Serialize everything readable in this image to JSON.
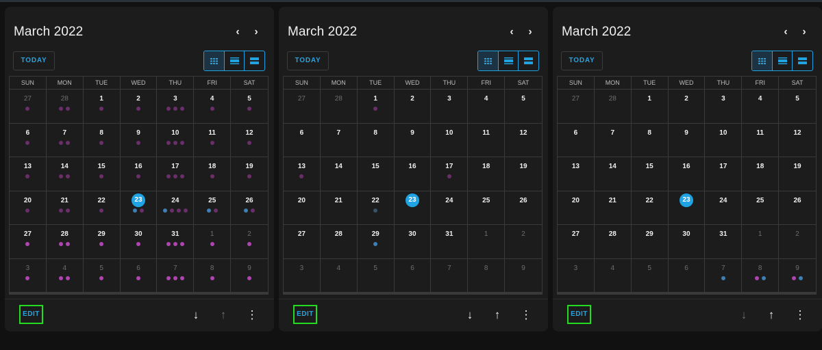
{
  "colors": {
    "accent": "#1fa3e3",
    "purple_dim": "#6a2f6a",
    "purple": "#b044b0",
    "blue": "#3f7fb3",
    "disabled": "#6e6e6e"
  },
  "icons": {
    "prev": "chevron-left-icon",
    "next": "chevron-right-icon",
    "month_view": "grid-icon",
    "week_view": "list-icon",
    "day_view": "agenda-icon",
    "down": "arrow-down-icon",
    "up": "arrow-up-icon",
    "more": "dots-vertical-icon"
  },
  "cards": [
    {
      "title": "March 2022",
      "today_label": "TODAY",
      "edit_label": "EDIT",
      "down_disabled": false,
      "up_disabled": true,
      "weekdays": [
        "SUN",
        "MON",
        "TUE",
        "WED",
        "THU",
        "FRI",
        "SAT"
      ],
      "days": [
        {
          "d": "27",
          "o": true,
          "dots": [
            "pd"
          ]
        },
        {
          "d": "28",
          "o": true,
          "dots": [
            "pd",
            "pd"
          ]
        },
        {
          "d": "1",
          "dots": [
            "pd"
          ]
        },
        {
          "d": "2",
          "dots": [
            "pd"
          ]
        },
        {
          "d": "3",
          "dots": [
            "pd",
            "pd",
            "pd"
          ]
        },
        {
          "d": "4",
          "dots": [
            "pd"
          ]
        },
        {
          "d": "5",
          "dots": [
            "pd"
          ]
        },
        {
          "d": "6",
          "dots": [
            "pd"
          ]
        },
        {
          "d": "7",
          "dots": [
            "pd",
            "pd"
          ]
        },
        {
          "d": "8",
          "dots": [
            "pd"
          ]
        },
        {
          "d": "9",
          "dots": [
            "pd"
          ]
        },
        {
          "d": "10",
          "dots": [
            "pd",
            "pd",
            "pd"
          ]
        },
        {
          "d": "11",
          "dots": [
            "pd"
          ]
        },
        {
          "d": "12",
          "dots": [
            "pd"
          ]
        },
        {
          "d": "13",
          "dots": [
            "pd"
          ]
        },
        {
          "d": "14",
          "dots": [
            "pd",
            "pd"
          ]
        },
        {
          "d": "15",
          "dots": [
            "pd"
          ]
        },
        {
          "d": "16",
          "dots": [
            "pd"
          ]
        },
        {
          "d": "17",
          "dots": [
            "pd",
            "pd",
            "pd"
          ]
        },
        {
          "d": "18",
          "dots": [
            "pd"
          ]
        },
        {
          "d": "19",
          "dots": [
            "pd"
          ]
        },
        {
          "d": "20",
          "dots": [
            "pd"
          ]
        },
        {
          "d": "21",
          "dots": [
            "pd",
            "pd"
          ]
        },
        {
          "d": "22",
          "dots": [
            "pd"
          ]
        },
        {
          "d": "23",
          "t": true,
          "dots": [
            "b",
            "pd"
          ]
        },
        {
          "d": "24",
          "dots": [
            "b",
            "pd",
            "pd",
            "pd"
          ]
        },
        {
          "d": "25",
          "dots": [
            "b",
            "pd"
          ]
        },
        {
          "d": "26",
          "dots": [
            "b",
            "pd"
          ]
        },
        {
          "d": "27",
          "dots": [
            "p"
          ]
        },
        {
          "d": "28",
          "dots": [
            "p",
            "p"
          ]
        },
        {
          "d": "29",
          "dots": [
            "p"
          ]
        },
        {
          "d": "30",
          "dots": [
            "p"
          ]
        },
        {
          "d": "31",
          "dots": [
            "p",
            "p",
            "p"
          ]
        },
        {
          "d": "1",
          "o": true,
          "dots": [
            "p"
          ]
        },
        {
          "d": "2",
          "o": true,
          "dots": [
            "p"
          ]
        },
        {
          "d": "3",
          "o": true,
          "dots": [
            "p"
          ]
        },
        {
          "d": "4",
          "o": true,
          "dots": [
            "p",
            "p"
          ]
        },
        {
          "d": "5",
          "o": true,
          "dots": [
            "p"
          ]
        },
        {
          "d": "6",
          "o": true,
          "dots": [
            "p"
          ]
        },
        {
          "d": "7",
          "o": true,
          "dots": [
            "p",
            "p",
            "p"
          ]
        },
        {
          "d": "8",
          "o": true,
          "dots": [
            "p"
          ]
        },
        {
          "d": "9",
          "o": true,
          "dots": [
            "p"
          ]
        }
      ]
    },
    {
      "title": "March 2022",
      "today_label": "TODAY",
      "edit_label": "EDIT",
      "down_disabled": false,
      "up_disabled": false,
      "weekdays": [
        "SUN",
        "MON",
        "TUE",
        "WED",
        "THU",
        "FRI",
        "SAT"
      ],
      "days": [
        {
          "d": "27",
          "o": true,
          "dots": []
        },
        {
          "d": "28",
          "o": true,
          "dots": []
        },
        {
          "d": "1",
          "dots": [
            "pd"
          ]
        },
        {
          "d": "2",
          "dots": []
        },
        {
          "d": "3",
          "dots": []
        },
        {
          "d": "4",
          "dots": []
        },
        {
          "d": "5",
          "dots": []
        },
        {
          "d": "6",
          "dots": []
        },
        {
          "d": "7",
          "dots": []
        },
        {
          "d": "8",
          "dots": []
        },
        {
          "d": "9",
          "dots": []
        },
        {
          "d": "10",
          "dots": []
        },
        {
          "d": "11",
          "dots": []
        },
        {
          "d": "12",
          "dots": []
        },
        {
          "d": "13",
          "dots": [
            "pd"
          ]
        },
        {
          "d": "14",
          "dots": []
        },
        {
          "d": "15",
          "dots": []
        },
        {
          "d": "16",
          "dots": []
        },
        {
          "d": "17",
          "dots": [
            "pd"
          ]
        },
        {
          "d": "18",
          "dots": []
        },
        {
          "d": "19",
          "dots": []
        },
        {
          "d": "20",
          "dots": []
        },
        {
          "d": "21",
          "dots": []
        },
        {
          "d": "22",
          "dots": [
            "bd"
          ]
        },
        {
          "d": "23",
          "t": true,
          "dots": []
        },
        {
          "d": "24",
          "dots": []
        },
        {
          "d": "25",
          "dots": []
        },
        {
          "d": "26",
          "dots": []
        },
        {
          "d": "27",
          "dots": []
        },
        {
          "d": "28",
          "dots": []
        },
        {
          "d": "29",
          "dots": [
            "b"
          ]
        },
        {
          "d": "30",
          "dots": []
        },
        {
          "d": "31",
          "dots": []
        },
        {
          "d": "1",
          "o": true,
          "dots": []
        },
        {
          "d": "2",
          "o": true,
          "dots": []
        },
        {
          "d": "3",
          "o": true,
          "dots": []
        },
        {
          "d": "4",
          "o": true,
          "dots": []
        },
        {
          "d": "5",
          "o": true,
          "dots": []
        },
        {
          "d": "6",
          "o": true,
          "dots": []
        },
        {
          "d": "7",
          "o": true,
          "dots": []
        },
        {
          "d": "8",
          "o": true,
          "dots": []
        },
        {
          "d": "9",
          "o": true,
          "dots": []
        }
      ]
    },
    {
      "title": "March 2022",
      "today_label": "TODAY",
      "edit_label": "EDIT",
      "down_disabled": true,
      "up_disabled": false,
      "weekdays": [
        "SUN",
        "MON",
        "TUE",
        "WED",
        "THU",
        "FRI",
        "SAT"
      ],
      "days": [
        {
          "d": "27",
          "o": true,
          "dots": []
        },
        {
          "d": "28",
          "o": true,
          "dots": []
        },
        {
          "d": "1",
          "dots": []
        },
        {
          "d": "2",
          "dots": []
        },
        {
          "d": "3",
          "dots": []
        },
        {
          "d": "4",
          "dots": []
        },
        {
          "d": "5",
          "dots": []
        },
        {
          "d": "6",
          "dots": []
        },
        {
          "d": "7",
          "dots": []
        },
        {
          "d": "8",
          "dots": []
        },
        {
          "d": "9",
          "dots": []
        },
        {
          "d": "10",
          "dots": []
        },
        {
          "d": "11",
          "dots": []
        },
        {
          "d": "12",
          "dots": []
        },
        {
          "d": "13",
          "dots": []
        },
        {
          "d": "14",
          "dots": []
        },
        {
          "d": "15",
          "dots": []
        },
        {
          "d": "16",
          "dots": []
        },
        {
          "d": "17",
          "dots": []
        },
        {
          "d": "18",
          "dots": []
        },
        {
          "d": "19",
          "dots": []
        },
        {
          "d": "20",
          "dots": []
        },
        {
          "d": "21",
          "dots": []
        },
        {
          "d": "22",
          "dots": []
        },
        {
          "d": "23",
          "t": true,
          "dots": []
        },
        {
          "d": "24",
          "dots": []
        },
        {
          "d": "25",
          "dots": []
        },
        {
          "d": "26",
          "dots": []
        },
        {
          "d": "27",
          "dots": []
        },
        {
          "d": "28",
          "dots": []
        },
        {
          "d": "29",
          "dots": []
        },
        {
          "d": "30",
          "dots": []
        },
        {
          "d": "31",
          "dots": []
        },
        {
          "d": "1",
          "o": true,
          "dots": []
        },
        {
          "d": "2",
          "o": true,
          "dots": []
        },
        {
          "d": "3",
          "o": true,
          "dots": []
        },
        {
          "d": "4",
          "o": true,
          "dots": []
        },
        {
          "d": "5",
          "o": true,
          "dots": []
        },
        {
          "d": "6",
          "o": true,
          "dots": []
        },
        {
          "d": "7",
          "o": true,
          "dots": [
            "b"
          ]
        },
        {
          "d": "8",
          "o": true,
          "dots": [
            "p",
            "b"
          ]
        },
        {
          "d": "9",
          "o": true,
          "dots": [
            "p",
            "b"
          ]
        }
      ]
    }
  ]
}
